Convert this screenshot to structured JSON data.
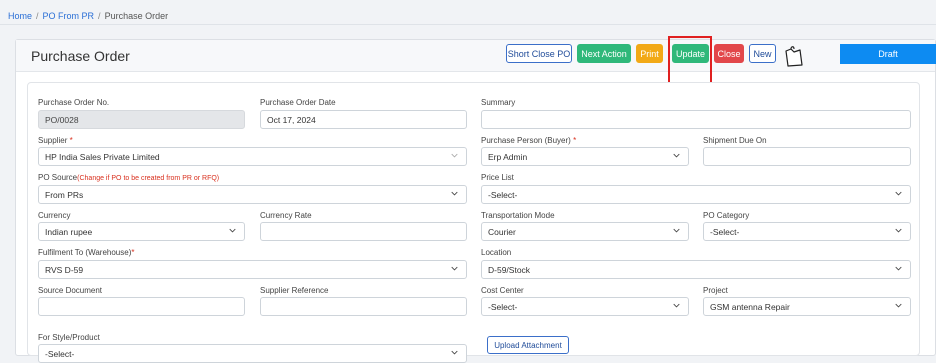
{
  "breadcrumb": {
    "home": "Home",
    "po_from_pr": "PO From PR",
    "current": "Purchase Order"
  },
  "header": {
    "title": "Purchase Order",
    "buttons": {
      "short_close": "Short Close PO",
      "next_action": "Next Action",
      "print": "Print",
      "update": "Update",
      "close": "Close",
      "new": "New"
    },
    "status": "Draft"
  },
  "form": {
    "po_no": {
      "label": "Purchase Order No.",
      "value": "PO/0028"
    },
    "po_date": {
      "label": "Purchase Order Date",
      "value": "Oct 17, 2024"
    },
    "summary": {
      "label": "Summary",
      "value": ""
    },
    "supplier": {
      "label": "Supplier",
      "required": "*",
      "value": "HP India Sales Private Limited"
    },
    "purchase_person": {
      "label": "Purchase Person (Buyer)",
      "required": "*",
      "value": "Erp Admin"
    },
    "shipment_due": {
      "label": "Shipment Due On",
      "value": ""
    },
    "po_source": {
      "label": "PO Source",
      "hint": "(Change if PO to be created from PR or RFQ)",
      "value": "From PRs"
    },
    "price_list": {
      "label": "Price List",
      "value": "-Select-"
    },
    "currency": {
      "label": "Currency",
      "value": "Indian rupee"
    },
    "currency_rate": {
      "label": "Currency Rate",
      "value": ""
    },
    "transport_mode": {
      "label": "Transportation Mode",
      "value": "Courier"
    },
    "po_category": {
      "label": "PO Category",
      "value": "-Select-"
    },
    "fulfilment": {
      "label": "Fulfilment To (Warehouse)",
      "required": "*",
      "value": "RVS D-59"
    },
    "location": {
      "label": "Location",
      "value": "D-59/Stock"
    },
    "source_doc": {
      "label": "Source Document",
      "value": ""
    },
    "supplier_ref": {
      "label": "Supplier Reference",
      "value": ""
    },
    "cost_center": {
      "label": "Cost Center",
      "value": "-Select-"
    },
    "project": {
      "label": "Project",
      "value": "GSM antenna Repair"
    },
    "style_product": {
      "label": "For Style/Product",
      "value": "-Select-"
    },
    "upload_attachment": "Upload Attachment"
  },
  "icons": {
    "chevron": "chevron-down-icon",
    "document": "document-icon"
  }
}
